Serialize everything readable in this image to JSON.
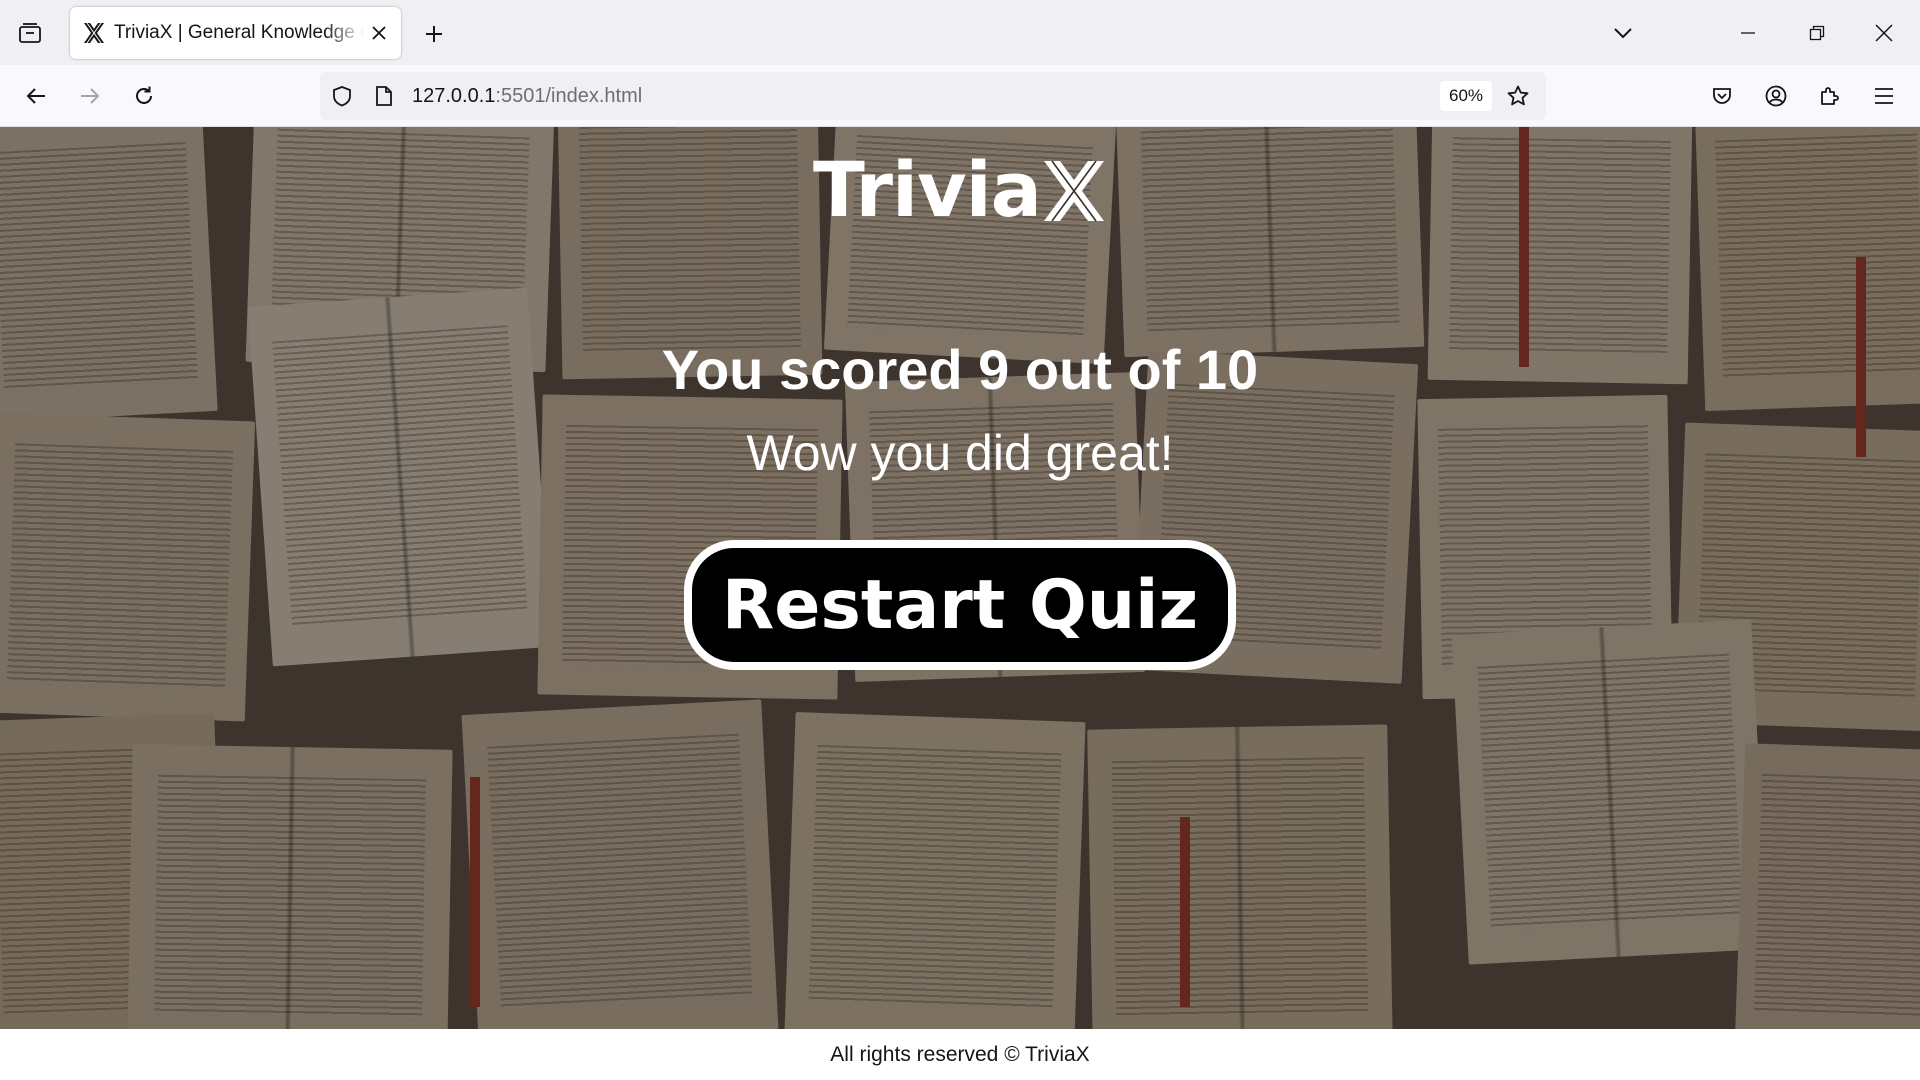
{
  "browser": {
    "tab": {
      "title": "TriviaX | General Knowledge Quiz",
      "favicon": "triviax-x-logo-icon"
    },
    "url": {
      "host": "127.0.0.1",
      "rest": ":5501/index.html"
    },
    "zoom": "60%",
    "icons": {
      "tab_list": "tab-list-icon",
      "new_tab": "plus-icon",
      "tab_overflow": "chevron-down-icon",
      "minimize": "minimize-icon",
      "restore": "restore-icon",
      "close": "close-icon",
      "back": "arrow-left-icon",
      "forward": "arrow-right-icon",
      "reload": "reload-icon",
      "shield": "shield-icon",
      "page": "page-icon",
      "bookmark": "star-icon",
      "pocket": "pocket-icon",
      "account": "account-icon",
      "extensions": "puzzle-icon",
      "menu": "hamburger-icon"
    }
  },
  "page": {
    "logo": {
      "text": "Trivia",
      "mark": "X"
    },
    "result": {
      "score_text": "You scored 9 out of 10",
      "score": 9,
      "total": 10,
      "message": "Wow you did great!"
    },
    "restart_label": "Restart Quiz",
    "footer": "All rights reserved © TriviaX"
  },
  "colors": {
    "chrome_bg": "#f0f0f4",
    "button_bg": "#000000",
    "button_border": "#ffffff",
    "text_on_image": "#ffffff"
  }
}
